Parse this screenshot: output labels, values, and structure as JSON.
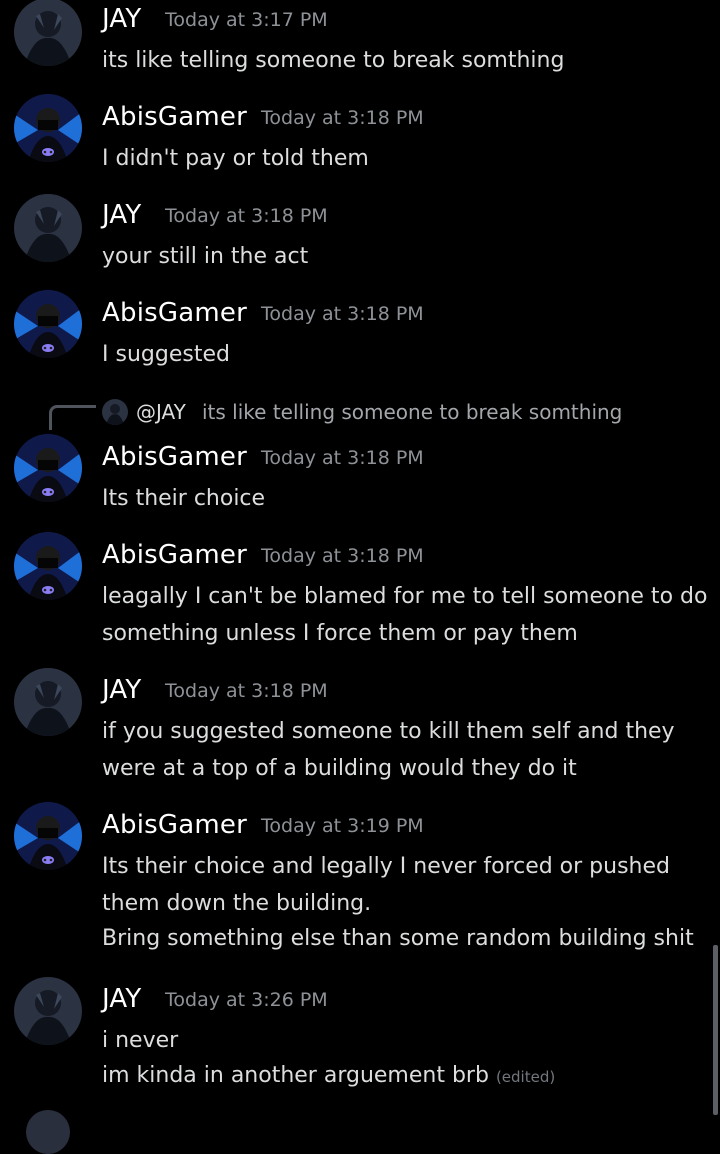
{
  "colors": {
    "background": "#000000",
    "username": "#ffffff",
    "timestamp": "#8e9297",
    "message_text": "#dcddde",
    "reply_text": "#a3a6aa",
    "edited_tag": "#72767d"
  },
  "messages": [
    {
      "author": "JAY",
      "timestamp": "Today at 3:17 PM",
      "lines": [
        "its like telling someone to break somthing"
      ]
    },
    {
      "author": "AbisGamer",
      "timestamp": "Today at 3:18 PM",
      "lines": [
        "I didn't pay or told them"
      ]
    },
    {
      "author": "JAY",
      "timestamp": "Today at 3:18 PM",
      "lines": [
        "your still in the act"
      ]
    },
    {
      "author": "AbisGamer",
      "timestamp": "Today at 3:18 PM",
      "lines": [
        "I suggested"
      ]
    },
    {
      "author": "AbisGamer",
      "timestamp": "Today at 3:18 PM",
      "lines": [
        "Its their choice"
      ]
    },
    {
      "author": "AbisGamer",
      "timestamp": "Today at 3:18 PM",
      "lines": [
        "leagally I can't be blamed for me to tell someone to do",
        "something unless I force them or pay them"
      ]
    },
    {
      "author": "JAY",
      "timestamp": "Today at 3:18 PM",
      "lines": [
        "if you suggested someone to kill them self and they",
        "were at a top of a building would they do it"
      ]
    },
    {
      "author": "AbisGamer",
      "timestamp": "Today at 3:19 PM",
      "lines": [
        "Its their choice and legally I never forced or pushed",
        "them down the building.",
        "Bring something else than some random building shit"
      ]
    },
    {
      "author": "JAY",
      "timestamp": "Today at 3:26 PM",
      "lines": [
        "i never",
        "im kinda in another arguement brb"
      ],
      "edited_label": "(edited)"
    }
  ],
  "reply": {
    "mention": "@JAY",
    "text": "its like telling someone to break somthing"
  },
  "icons": {
    "jay_avatar": "dark-anime-avatar-icon",
    "abis_avatar": "masked-gamer-avatar-icon",
    "reply_connector": "reply-connector-icon"
  }
}
